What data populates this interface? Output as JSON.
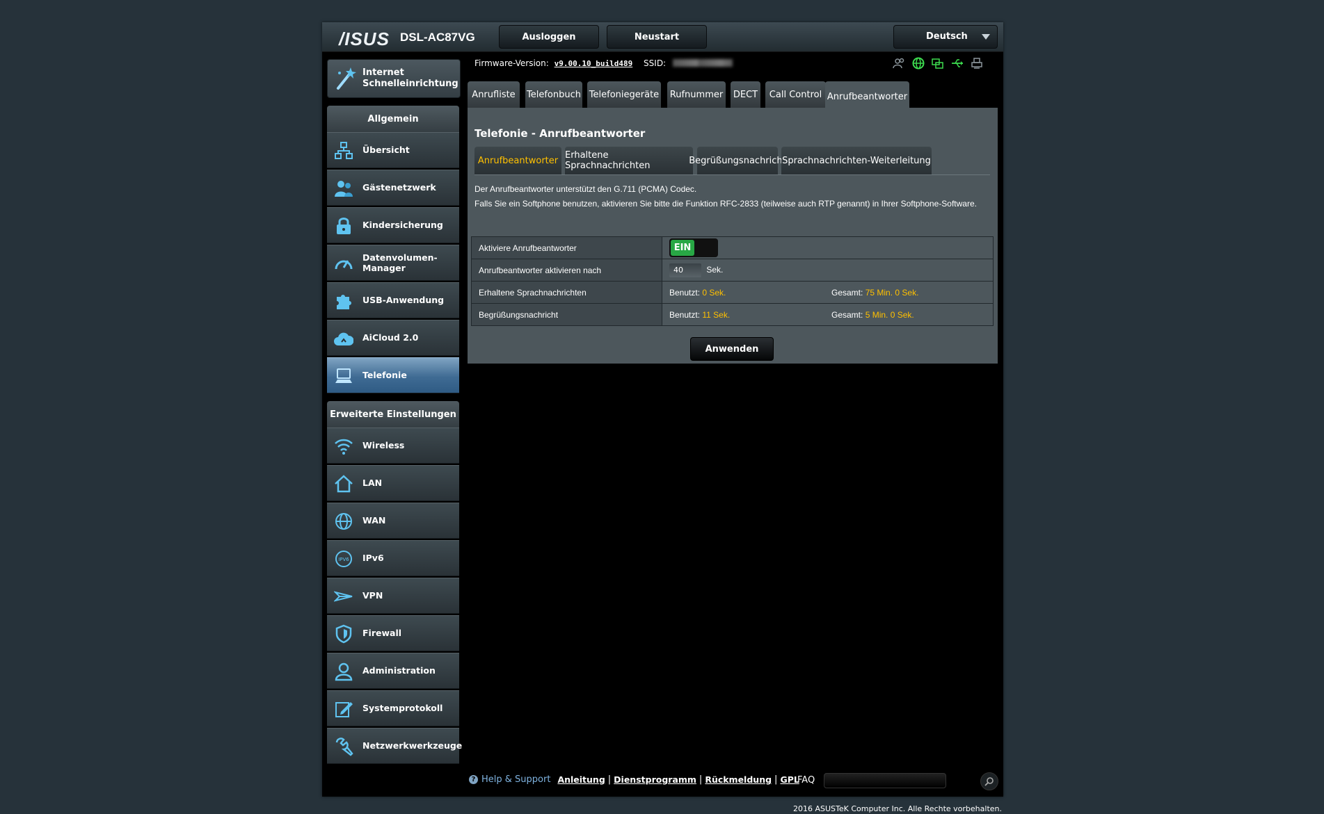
{
  "header": {
    "brand": "/ISUS",
    "model": "DSL-AC87VG",
    "logout_label": "Ausloggen",
    "reboot_label": "Neustart",
    "language": "Deutsch"
  },
  "info": {
    "firmware_label": "Firmware-Version:",
    "firmware_value": "v9.00.10_build489",
    "ssid_label": "SSID:"
  },
  "status_icons": [
    "users-icon",
    "internet-globe-icon",
    "network-devices-icon",
    "usb-icon",
    "printer-icon"
  ],
  "sidebar": {
    "quick_setup": "Internet Schnelleinrichtung",
    "general_header": "Allgemein",
    "general_items": [
      {
        "label": "Übersicht",
        "icon": "network-map-icon"
      },
      {
        "label": "Gästenetzwerk",
        "icon": "guest-network-icon"
      },
      {
        "label": "Kindersicherung",
        "icon": "parental-lock-icon"
      },
      {
        "label": "Datenvolumen-Manager",
        "icon": "speedometer-icon"
      },
      {
        "label": "USB-Anwendung",
        "icon": "puzzle-icon"
      },
      {
        "label": "AiCloud 2.0",
        "icon": "cloud-icon"
      },
      {
        "label": "Telefonie",
        "icon": "telephony-icon",
        "active": true
      }
    ],
    "advanced_header": "Erweiterte Einstellungen",
    "advanced_items": [
      {
        "label": "Wireless",
        "icon": "wifi-icon"
      },
      {
        "label": "LAN",
        "icon": "home-icon"
      },
      {
        "label": "WAN",
        "icon": "globe-icon"
      },
      {
        "label": "IPv6",
        "icon": "ipv6-icon"
      },
      {
        "label": "VPN",
        "icon": "vpn-icon"
      },
      {
        "label": "Firewall",
        "icon": "shield-icon"
      },
      {
        "label": "Administration",
        "icon": "admin-user-icon"
      },
      {
        "label": "Systemprotokoll",
        "icon": "log-edit-icon"
      },
      {
        "label": "Netzwerkwerkzeuge",
        "icon": "wrench-icon"
      }
    ]
  },
  "tabs": [
    "Anrufliste",
    "Telefonbuch",
    "Telefoniegeräte",
    "Rufnummer",
    "DECT",
    "Call Control",
    "Anrufbeantworter"
  ],
  "active_tab": "Anrufbeantworter",
  "page": {
    "title": "Telefonie - Anrufbeantworter",
    "subtabs": [
      "Anrufbeantworter",
      "Erhaltene Sprachnachrichten",
      "Begrüßungsnachricht",
      "Sprachnachrichten-Weiterleitung"
    ],
    "active_subtab": "Anrufbeantworter",
    "desc_line1": "Der Anrufbeantworter unterstützt den G.711 (PCMA) Codec.",
    "desc_line2": "Falls Sie ein Softphone benutzen, aktivieren Sie bitte die Funktion RFC-2833 (teilweise auch RTP genannt) in Ihrer Softphone-Software."
  },
  "settings": {
    "activate_label": "Aktiviere Anrufbeantworter",
    "activate_state": "EIN",
    "delay_label": "Anrufbeantworter aktivieren nach",
    "delay_value": "40",
    "delay_unit": "Sek.",
    "received_label": "Erhaltene Sprachnachrichten",
    "received_used_label": "Benutzt:",
    "received_used_value": "0 Sek.",
    "received_total_label": "Gesamt:",
    "received_total_value": "75 Min. 0 Sek.",
    "greeting_label": "Begrüßungsnachricht",
    "greeting_used_label": "Benutzt:",
    "greeting_used_value": "11 Sek.",
    "greeting_total_label": "Gesamt:",
    "greeting_total_value": "5 Min. 0 Sek."
  },
  "apply_label": "Anwenden",
  "footer": {
    "help": "Help & Support",
    "links": [
      "Anleitung",
      "Dienstprogramm",
      "Rückmeldung",
      "GPL"
    ],
    "faq": "FAQ",
    "copyright": "2016 ASUSTeK Computer Inc. Alle Rechte vorbehalten."
  },
  "colors": {
    "accent_yellow": "#ffc000",
    "active_menu_blue": "#3f6b93",
    "toggle_green": "#28a745",
    "icon_blue": "#5fc3f0",
    "status_green": "#3ddc4f"
  }
}
